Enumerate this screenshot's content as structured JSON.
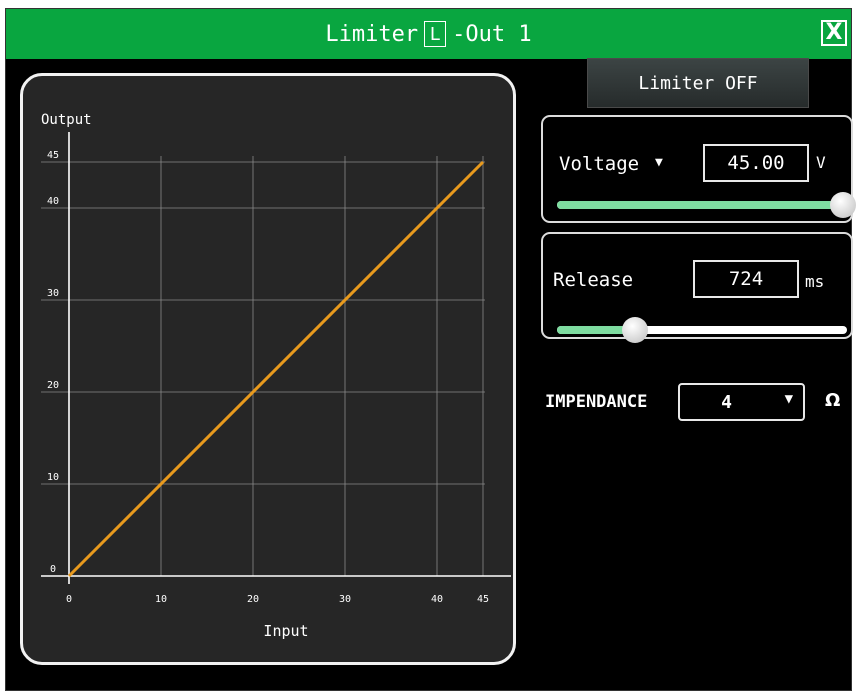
{
  "window": {
    "title_prefix": "Limiter",
    "title_box": "L",
    "title_suffix": "-Out 1",
    "close_symbol": "X",
    "colors": {
      "titlebar": "#09a640",
      "background": "#000000",
      "curve": "#e89a1e",
      "slider_fill": "#7edca0"
    }
  },
  "limiter_button": {
    "label": "Limiter OFF"
  },
  "voltage": {
    "label": "Voltage",
    "caret": "▼",
    "value": "45.00",
    "unit": "V",
    "slider_level": 1.0
  },
  "release": {
    "label": "Release",
    "value": "724",
    "unit": "ms",
    "slider_level": 0.27
  },
  "impedance": {
    "label": "IMPENDANCE",
    "value": "4",
    "caret": "▼",
    "unit": "Ω"
  },
  "chart_data": {
    "type": "line",
    "ylabel": "Output",
    "xlabel": "Input",
    "x_ticks": [
      "0",
      "10",
      "20",
      "30",
      "40",
      "45"
    ],
    "y_ticks": [
      "0",
      "10",
      "20",
      "30",
      "40",
      "45"
    ],
    "xlim": [
      0,
      45
    ],
    "ylim": [
      0,
      45
    ],
    "grid": true,
    "series": [
      {
        "x": [
          0,
          45
        ],
        "y": [
          0,
          45
        ]
      }
    ]
  }
}
